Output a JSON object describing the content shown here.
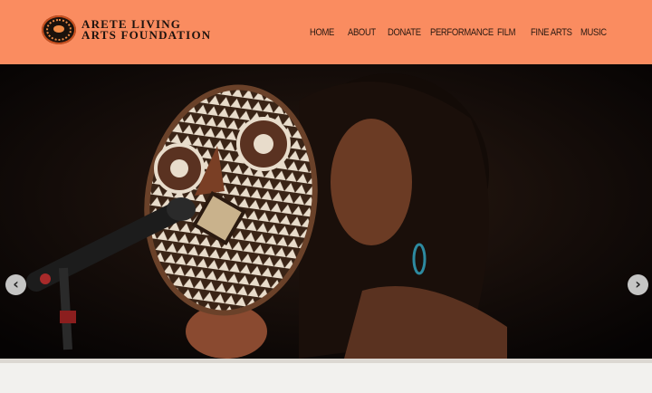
{
  "site": {
    "logo_line1": "Arete Living",
    "logo_line2": "Arts Foundation"
  },
  "nav": {
    "items": [
      "HOME",
      "ABOUT",
      "DONATE",
      "PERFORMANCE",
      "FILM",
      "FINE ARTS",
      "MUSIC"
    ]
  },
  "slider": {
    "prev_icon": "chevron-left-icon",
    "next_icon": "chevron-right-icon",
    "prev_glyph": "‹",
    "next_glyph": "›"
  },
  "colors": {
    "header_bg": "#fa8c60",
    "nav_text": "#2b1a12",
    "hero_bg": "#0a0706"
  }
}
